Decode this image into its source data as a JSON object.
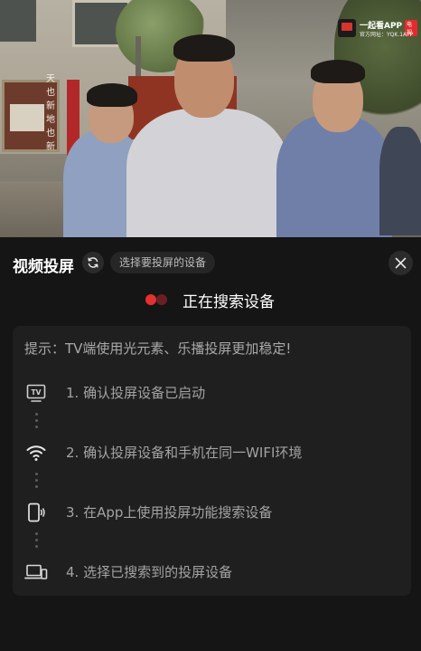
{
  "video": {
    "vertical_text": "天也新地也新",
    "watermark": {
      "brand": "一起看APP",
      "tag": "电视",
      "small_logo_text": "一起看",
      "url_line": "官方网址：YQK.1APP"
    }
  },
  "cast_panel": {
    "title": "视频投屏",
    "refresh_icon": "refresh-icon",
    "hint": "选择要投屏的设备",
    "close_icon": "close-icon",
    "status": "正在搜索设备",
    "status_colors": {
      "dot_active": "#e43030",
      "dot_dim": "#6c1f23"
    },
    "tip": "提示：TV端使用光元素、乐播投屏更加稳定!",
    "steps": [
      {
        "icon": "tv-icon",
        "text": "1. 确认投屏设备已启动"
      },
      {
        "icon": "wifi-icon",
        "text": "2. 确认投屏设备和手机在同一WIFI环境"
      },
      {
        "icon": "phone-cast-icon",
        "text": "3. 在App上使用投屏功能搜索设备"
      },
      {
        "icon": "devices-icon",
        "text": "4. 选择已搜索到的投屏设备"
      }
    ]
  }
}
